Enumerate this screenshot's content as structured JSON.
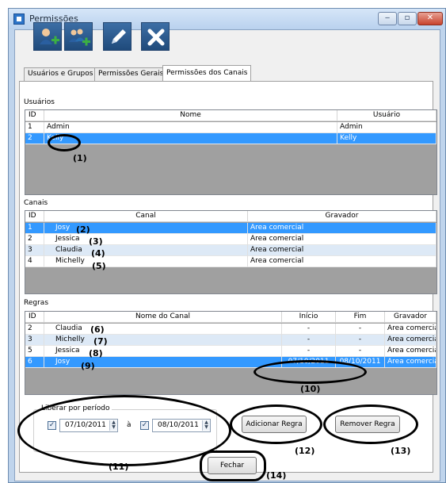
{
  "window": {
    "title": "Permissões",
    "controls": {
      "minimize": "‒",
      "maximize": "▫",
      "close": "✕"
    }
  },
  "toolbar": {
    "buttons": [
      "add-user-icon",
      "add-group-icon",
      "edit-pencil-icon",
      "delete-x-icon"
    ]
  },
  "tabs": [
    "Usuários e Grupos",
    "Permissões Gerais",
    "Permissões dos Canais"
  ],
  "active_tab": "Permissões dos Canais",
  "usuarios": {
    "label": "Usuários",
    "columns": [
      "ID",
      "Nome",
      "Usuário"
    ],
    "rows": [
      {
        "id": "1",
        "nome": "Admin",
        "usuario": "Admin"
      },
      {
        "id": "2",
        "nome": "Kelly",
        "usuario": "Kelly"
      }
    ]
  },
  "canais": {
    "label": "Canais",
    "columns": [
      "ID",
      "Canal",
      "Gravador"
    ],
    "rows": [
      {
        "id": "1",
        "canal": "Josy",
        "gravador": "Area comercial"
      },
      {
        "id": "2",
        "canal": "Jessica",
        "gravador": "Area comercial"
      },
      {
        "id": "3",
        "canal": "Claudia",
        "gravador": "Area comercial"
      },
      {
        "id": "4",
        "canal": "Michelly",
        "gravador": "Area comercial"
      }
    ]
  },
  "regras": {
    "label": "Regras",
    "columns": [
      "ID",
      "Nome do Canal",
      "Início",
      "Fim",
      "Gravador"
    ],
    "rows": [
      {
        "id": "2",
        "nome": "Claudia",
        "inicio": "-",
        "fim": "-",
        "gravador": "Area comercial"
      },
      {
        "id": "3",
        "nome": "Michelly",
        "inicio": "-",
        "fim": "-",
        "gravador": "Area comercial"
      },
      {
        "id": "5",
        "nome": "Jessica",
        "inicio": "-",
        "fim": "-",
        "gravador": "Area comercial"
      },
      {
        "id": "6",
        "nome": "Josy",
        "inicio": "07/10/2011",
        "fim": "08/10/2011",
        "gravador": "Area comercial"
      }
    ]
  },
  "liberar": {
    "label": "Liberar por período",
    "start_checked": true,
    "start_date": "07/10/2011",
    "separator": "à",
    "end_checked": true,
    "end_date": "08/10/2011"
  },
  "buttons": {
    "adicionar": "Adicionar Regra",
    "remover": "Remover Regra",
    "fechar": "Fechar"
  },
  "annotations": [
    "(1)",
    "(2)",
    "(3)",
    "(4)",
    "(5)",
    "(6)",
    "(7)",
    "(8)",
    "(9)",
    "(10)",
    "(11)",
    "(12)",
    "(13)",
    "(14)"
  ],
  "colors": {
    "selection": "#3399ff",
    "alt_row": "#dde9f6",
    "toolbar_button": "#1f4a7b",
    "annotation": "#000000"
  }
}
